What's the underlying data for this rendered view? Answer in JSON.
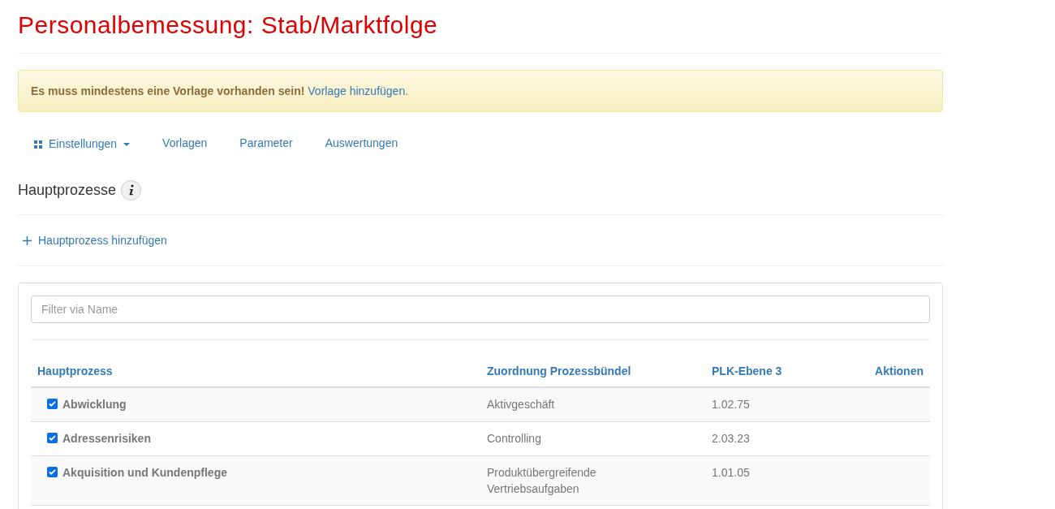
{
  "page_title": "Personalbemessung: Stab/Marktfolge",
  "alert": {
    "message": "Es muss mindestens eine Vorlage vorhanden sein!",
    "link": "Vorlage hinzufügen",
    "suffix": "."
  },
  "nav": [
    {
      "label": "Einstellungen",
      "kind": "dropdown"
    },
    {
      "label": "Vorlagen",
      "kind": "link"
    },
    {
      "label": "Parameter",
      "kind": "link"
    },
    {
      "label": "Auswertungen",
      "kind": "link"
    }
  ],
  "section": {
    "title": "Hauptprozesse",
    "add_link": "Hauptprozess hinzufügen"
  },
  "filter": {
    "placeholder": "Filter via Name"
  },
  "table": {
    "columns": [
      "Hauptprozess",
      "Zuordnung Prozessbündel",
      "PLK-Ebene 3",
      "Aktionen"
    ],
    "rows": [
      {
        "checked": true,
        "name": "Abwicklung",
        "bundle": "Aktivgeschäft",
        "plk": "1.02.75"
      },
      {
        "checked": true,
        "name": "Adressenrisiken",
        "bundle": "Controlling",
        "plk": "2.03.23"
      },
      {
        "checked": true,
        "name": "Akquisition und Kundenpflege",
        "bundle": "Produktübergreifende Vertriebsaufgaben",
        "plk": "1.01.05"
      }
    ]
  }
}
